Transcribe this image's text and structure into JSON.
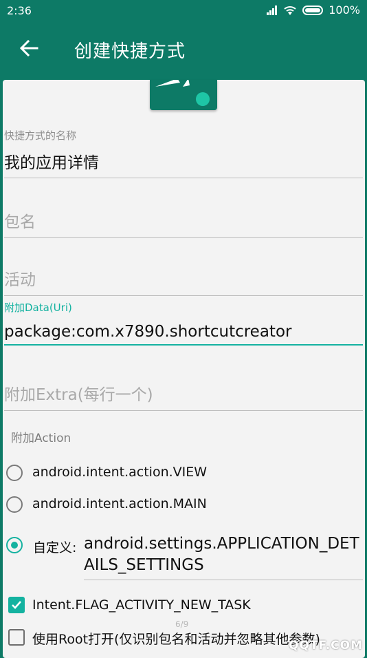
{
  "status": {
    "time": "2:36",
    "battery": "100%"
  },
  "appbar": {
    "title": "创建快捷方式"
  },
  "fields": {
    "name_label": "快捷方式的名称",
    "name_value": "我的应用详情",
    "package_hint": "包名",
    "activity_hint": "活动",
    "data_label": "附加Data(Uri)",
    "data_value": "package:com.x7890.shortcutcreator",
    "extra_hint": "附加Extra(每行一个)"
  },
  "action": {
    "label": "附加Action",
    "options": [
      {
        "label": "android.intent.action.VIEW",
        "selected": false
      },
      {
        "label": "android.intent.action.MAIN",
        "selected": false
      }
    ],
    "custom_label": "自定义:",
    "custom_value": "android.settings.APPLICATION_DETAILS_SETTINGS",
    "custom_selected": true
  },
  "flags": {
    "new_task": "Intent.FLAG_ACTIVITY_NEW_TASK",
    "new_task_checked": true,
    "root": "使用Root打开(仅识别包名和活动并忽略其他参数)",
    "root_checked": false
  },
  "page_indicator": "6/9",
  "watermark": "QQTF.COM",
  "colors": {
    "primary": "#0d7a66",
    "accent": "#14b2a0",
    "background": "#f3f3f3"
  }
}
